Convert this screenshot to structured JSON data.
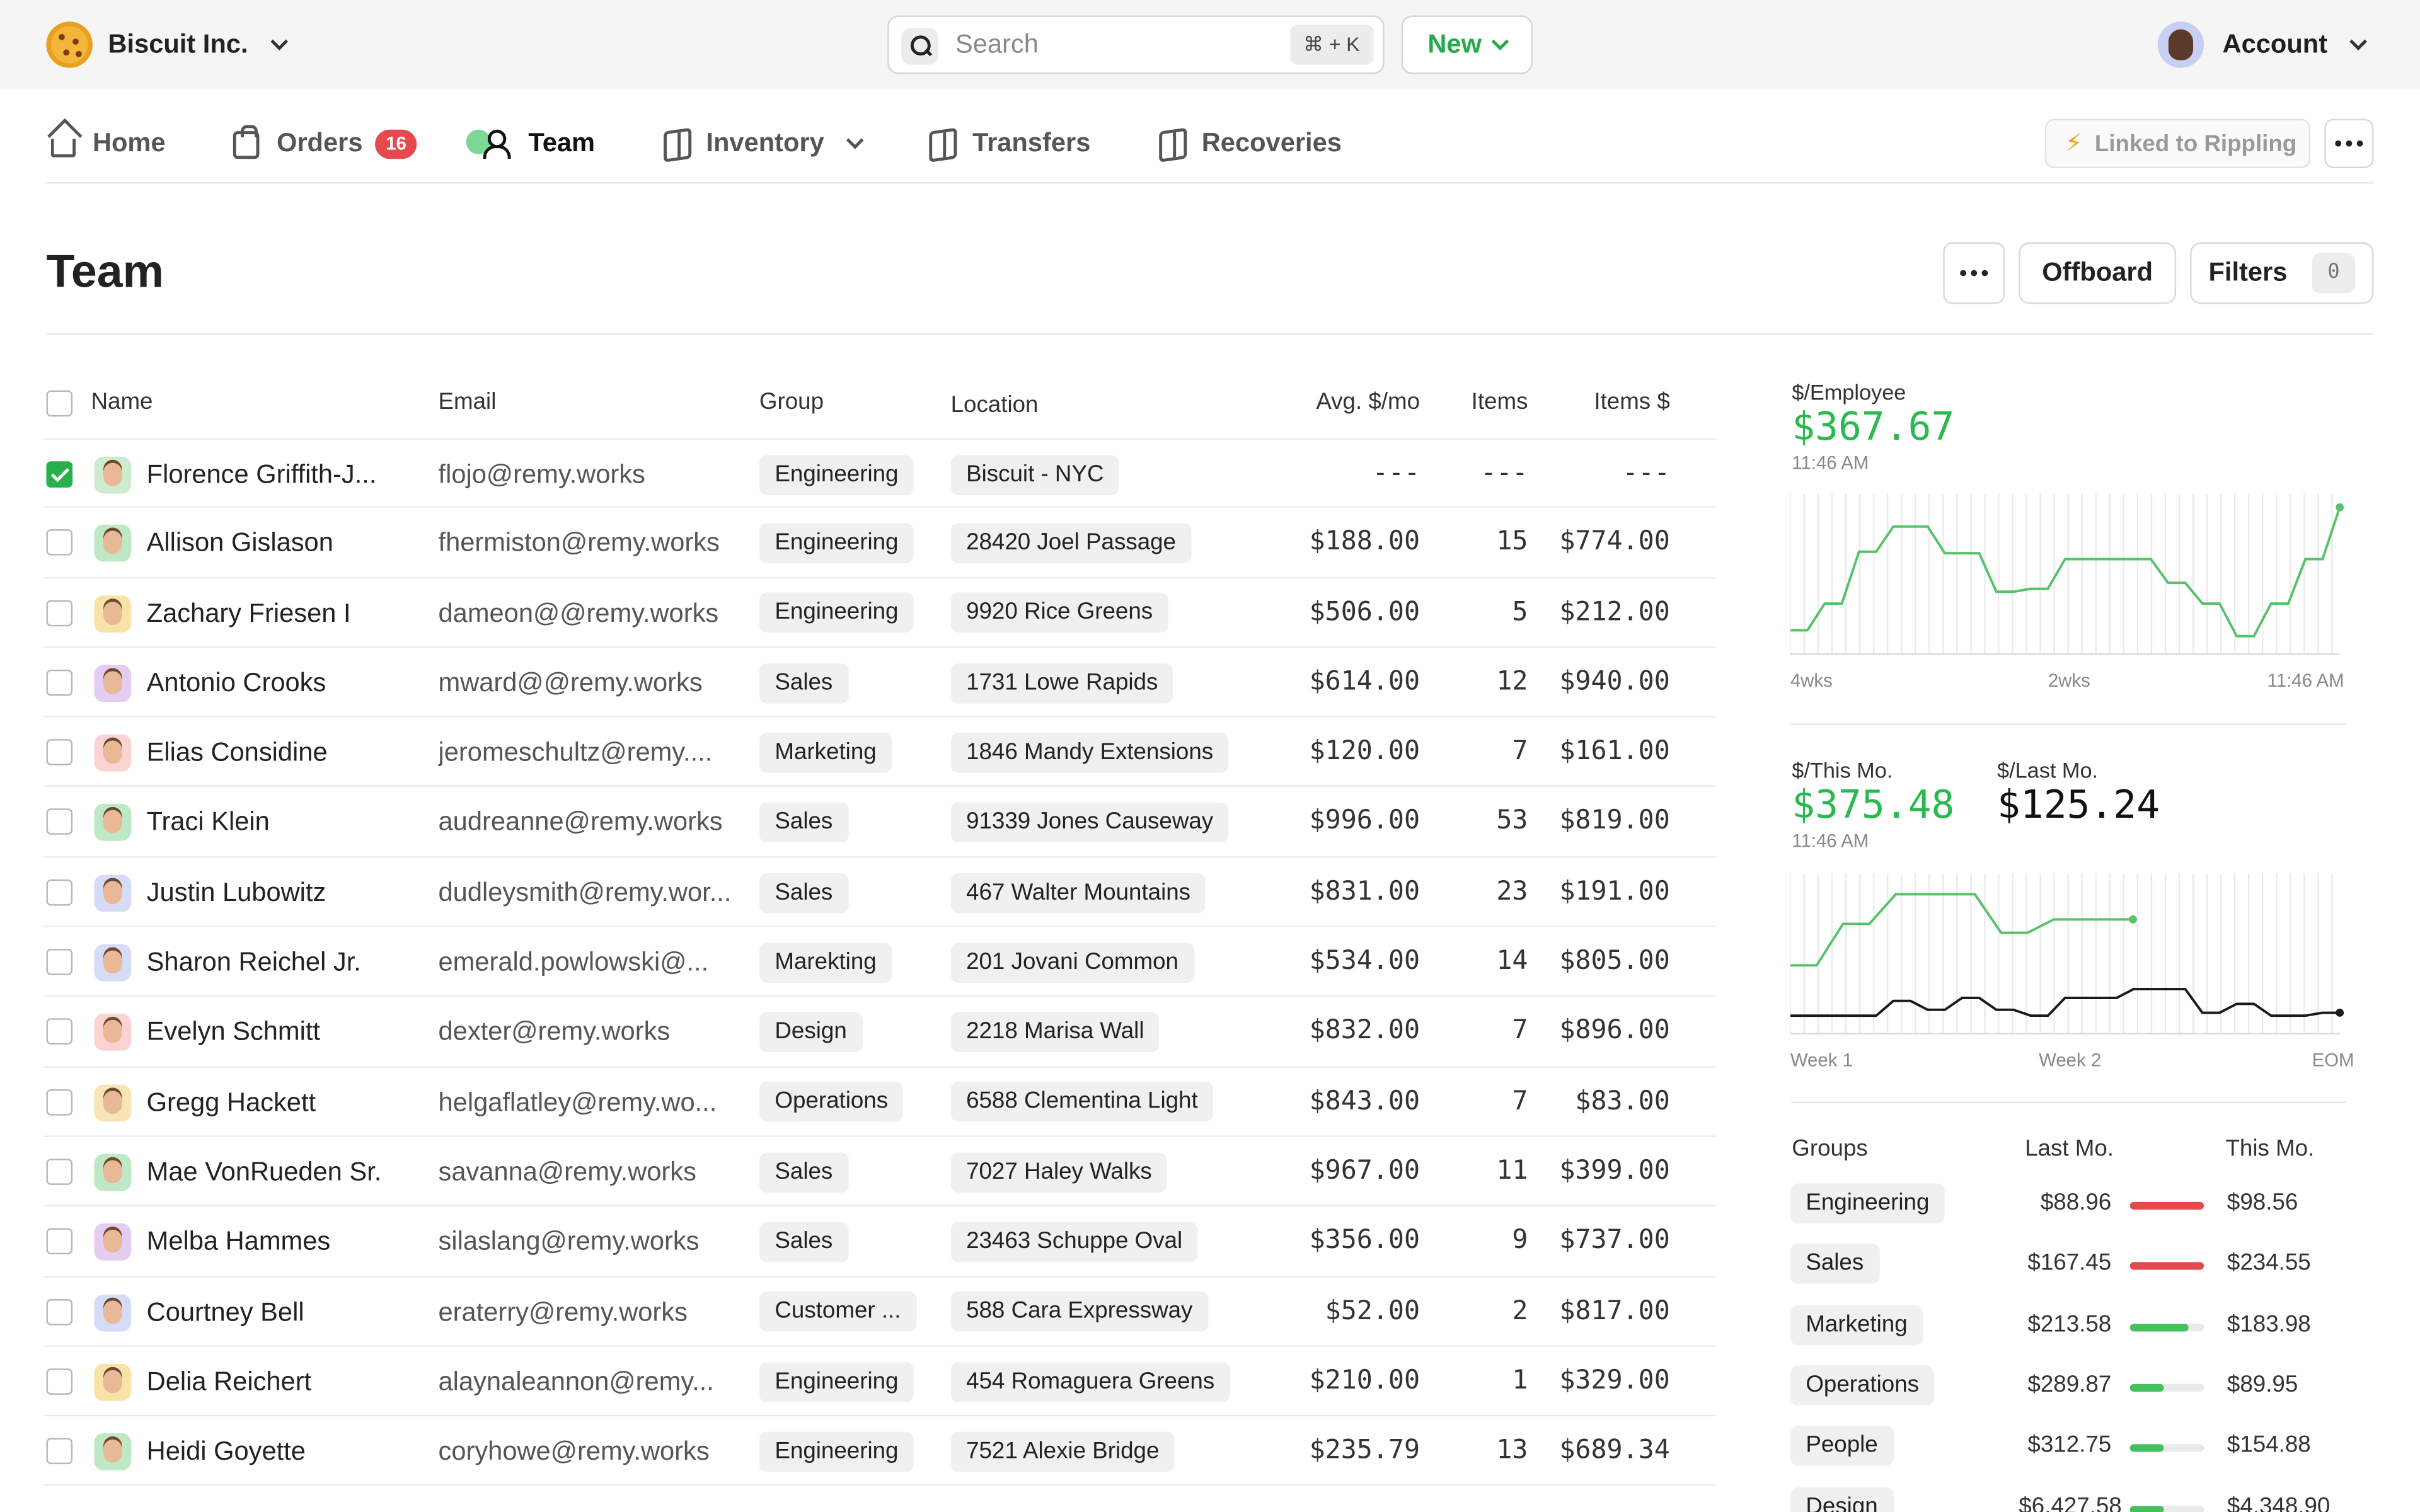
{
  "topbar": {
    "org_name": "Biscuit Inc.",
    "search_placeholder": "Search",
    "search_shortcut": "⌘ + K",
    "new_label": "New",
    "account_label": "Account"
  },
  "nav": {
    "home": "Home",
    "orders": "Orders",
    "orders_badge": "16",
    "team": "Team",
    "inventory": "Inventory",
    "transfers": "Transfers",
    "recoveries": "Recoveries",
    "rippling": "Linked to Rippling"
  },
  "page": {
    "title": "Team",
    "offboard_label": "Offboard",
    "filters_label": "Filters",
    "filters_count": "0"
  },
  "table": {
    "columns": {
      "name": "Name",
      "email": "Email",
      "group": "Group",
      "location": "Location",
      "avg": "Avg. $/mo",
      "items": "Items",
      "items_value": "Items $"
    },
    "rows": [
      {
        "checked": true,
        "avatar": "#cdeccf",
        "name": "Florence Griffith-J...",
        "email": "flojo@remy.works",
        "group": "Engineering",
        "location": "Biscuit - NYC",
        "avg": "---",
        "items": "---",
        "items_value": "---"
      },
      {
        "checked": false,
        "avatar": "#bfe8c6",
        "name": "Allison Gislason",
        "email": "fhermiston@remy.works",
        "group": "Engineering",
        "location": "28420 Joel Passage",
        "avg": "$188.00",
        "items": "15",
        "items_value": "$774.00"
      },
      {
        "checked": false,
        "avatar": "#f7e3a6",
        "name": "Zachary Friesen I",
        "email": "dameon@@remy.works",
        "group": "Engineering",
        "location": "9920 Rice Greens",
        "avg": "$506.00",
        "items": "5",
        "items_value": "$212.00"
      },
      {
        "checked": false,
        "avatar": "#e5ccf2",
        "name": "Antonio Crooks",
        "email": "mward@@remy.works",
        "group": "Sales",
        "location": "1731 Lowe Rapids",
        "avg": "$614.00",
        "items": "12",
        "items_value": "$940.00"
      },
      {
        "checked": false,
        "avatar": "#fbd3d3",
        "name": "Elias Considine",
        "email": "jeromeschultz@remy....",
        "group": "Marketing",
        "location": "1846 Mandy Extensions",
        "avg": "$120.00",
        "items": "7",
        "items_value": "$161.00"
      },
      {
        "checked": false,
        "avatar": "#bfe8c6",
        "name": "Traci Klein",
        "email": "audreanne@remy.works",
        "group": "Sales",
        "location": "91339 Jones Causeway",
        "avg": "$996.00",
        "items": "53",
        "items_value": "$819.00"
      },
      {
        "checked": false,
        "avatar": "#d6dcf7",
        "name": "Justin Lubowitz",
        "email": "dudleysmith@remy.wor...",
        "group": "Sales",
        "location": "467 Walter Mountains",
        "avg": "$831.00",
        "items": "23",
        "items_value": "$191.00"
      },
      {
        "checked": false,
        "avatar": "#d6dcf7",
        "name": "Sharon Reichel Jr.",
        "email": "emerald.powlowski@...",
        "group": "Marekting",
        "location": "201 Jovani Common",
        "avg": "$534.00",
        "items": "14",
        "items_value": "$805.00"
      },
      {
        "checked": false,
        "avatar": "#fbd3d3",
        "name": "Evelyn Schmitt",
        "email": "dexter@remy.works",
        "group": "Design",
        "location": "2218 Marisa Wall",
        "avg": "$832.00",
        "items": "7",
        "items_value": "$896.00"
      },
      {
        "checked": false,
        "avatar": "#f9e4b5",
        "name": "Gregg Hackett",
        "email": "helgaflatley@remy.wo...",
        "group": "Operations",
        "location": "6588 Clementina Light",
        "avg": "$843.00",
        "items": "7",
        "items_value": "$83.00"
      },
      {
        "checked": false,
        "avatar": "#bfe8c6",
        "name": "Mae VonRueden Sr.",
        "email": "savanna@remy.works",
        "group": "Sales",
        "location": "7027 Haley Walks",
        "avg": "$967.00",
        "items": "11",
        "items_value": "$399.00"
      },
      {
        "checked": false,
        "avatar": "#e5ccf2",
        "name": "Melba Hammes",
        "email": "silaslang@remy.works",
        "group": "Sales",
        "location": "23463 Schuppe Oval",
        "avg": "$356.00",
        "items": "9",
        "items_value": "$737.00"
      },
      {
        "checked": false,
        "avatar": "#d6dcf7",
        "name": "Courtney Bell",
        "email": "eraterry@remy.works",
        "group": "Customer ...",
        "location": "588 Cara Expressway",
        "avg": "$52.00",
        "items": "2",
        "items_value": "$817.00"
      },
      {
        "checked": false,
        "avatar": "#f7e3a6",
        "name": "Delia Reichert",
        "email": "alaynaleannon@remy...",
        "group": "Engineering",
        "location": "454 Romaguera Greens",
        "avg": "$210.00",
        "items": "1",
        "items_value": "$329.00"
      },
      {
        "checked": false,
        "avatar": "#bfe8c6",
        "name": "Heidi Goyette",
        "email": "coryhowe@remy.works",
        "group": "Engineering",
        "location": "7521 Alexie Bridge",
        "avg": "$235.79",
        "items": "13",
        "items_value": "$689.34"
      }
    ]
  },
  "stats": {
    "per_employee_label": "$/Employee",
    "per_employee_value": "$367.67",
    "per_employee_time": "11:46 AM",
    "chart1_axis": [
      "4wks",
      "2wks",
      "11:46 AM"
    ],
    "this_mo_label": "$/This Mo.",
    "this_mo_value": "$375.48",
    "this_mo_time": "11:46 AM",
    "last_mo_label": "$/Last Mo.",
    "last_mo_value": "$125.24",
    "chart2_axis": [
      "Week 1",
      "Week 2",
      "EOM"
    ]
  },
  "chart_data": [
    {
      "type": "line",
      "color": "#56c26a",
      "series": [
        {
          "values": [
            0.12,
            0.12,
            0.3,
            0.3,
            0.65,
            0.65,
            0.82,
            0.82,
            0.82,
            0.64,
            0.64,
            0.64,
            0.38,
            0.38,
            0.4,
            0.4,
            0.6,
            0.6,
            0.6,
            0.6,
            0.6,
            0.6,
            0.44,
            0.44,
            0.3,
            0.3,
            0.08,
            0.08,
            0.3,
            0.3,
            0.6,
            0.6,
            0.95
          ]
        }
      ],
      "x_ticks": [
        "4wks",
        "2wks",
        "11:46 AM"
      ]
    },
    {
      "type": "line",
      "colors": [
        "#56c26a",
        "#1a1a1a"
      ],
      "series": [
        {
          "values": [
            0.42,
            0.42,
            0.7,
            0.7,
            0.9,
            0.9,
            0.9,
            0.9,
            0.64,
            0.64,
            0.73,
            0.73,
            0.73,
            0.73
          ]
        },
        {
          "values": [
            0.08,
            0.08,
            0.08,
            0.08,
            0.08,
            0.08,
            0.18,
            0.18,
            0.12,
            0.12,
            0.2,
            0.2,
            0.12,
            0.12,
            0.08,
            0.08,
            0.2,
            0.2,
            0.2,
            0.2,
            0.26,
            0.26,
            0.26,
            0.26,
            0.1,
            0.1,
            0.16,
            0.16,
            0.08,
            0.08,
            0.08,
            0.1,
            0.1
          ]
        }
      ],
      "x_ticks": [
        "Week 1",
        "Week 2",
        "EOM"
      ]
    }
  ],
  "groups": {
    "header": {
      "label": "Groups",
      "last": "Last Mo.",
      "this": "This Mo."
    },
    "rows": [
      {
        "name": "Engineering",
        "last": "$88.96",
        "this": "$98.56",
        "trend": 1.0,
        "color": "#e5484d"
      },
      {
        "name": "Sales",
        "last": "$167.45",
        "this": "$234.55",
        "trend": 1.0,
        "color": "#e5484d"
      },
      {
        "name": "Marketing",
        "last": "$213.58",
        "this": "$183.98",
        "trend": 0.8,
        "color": "#45c05e"
      },
      {
        "name": "Operations",
        "last": "$289.87",
        "this": "$89.95",
        "trend": 0.45,
        "color": "#45c05e"
      },
      {
        "name": "People",
        "last": "$312.75",
        "this": "$154.88",
        "trend": 0.45,
        "color": "#45c05e"
      },
      {
        "name": "Design",
        "last": "$6,427.58",
        "this": "$4,348.90",
        "trend": 0.45,
        "color": "#45c05e"
      }
    ]
  }
}
